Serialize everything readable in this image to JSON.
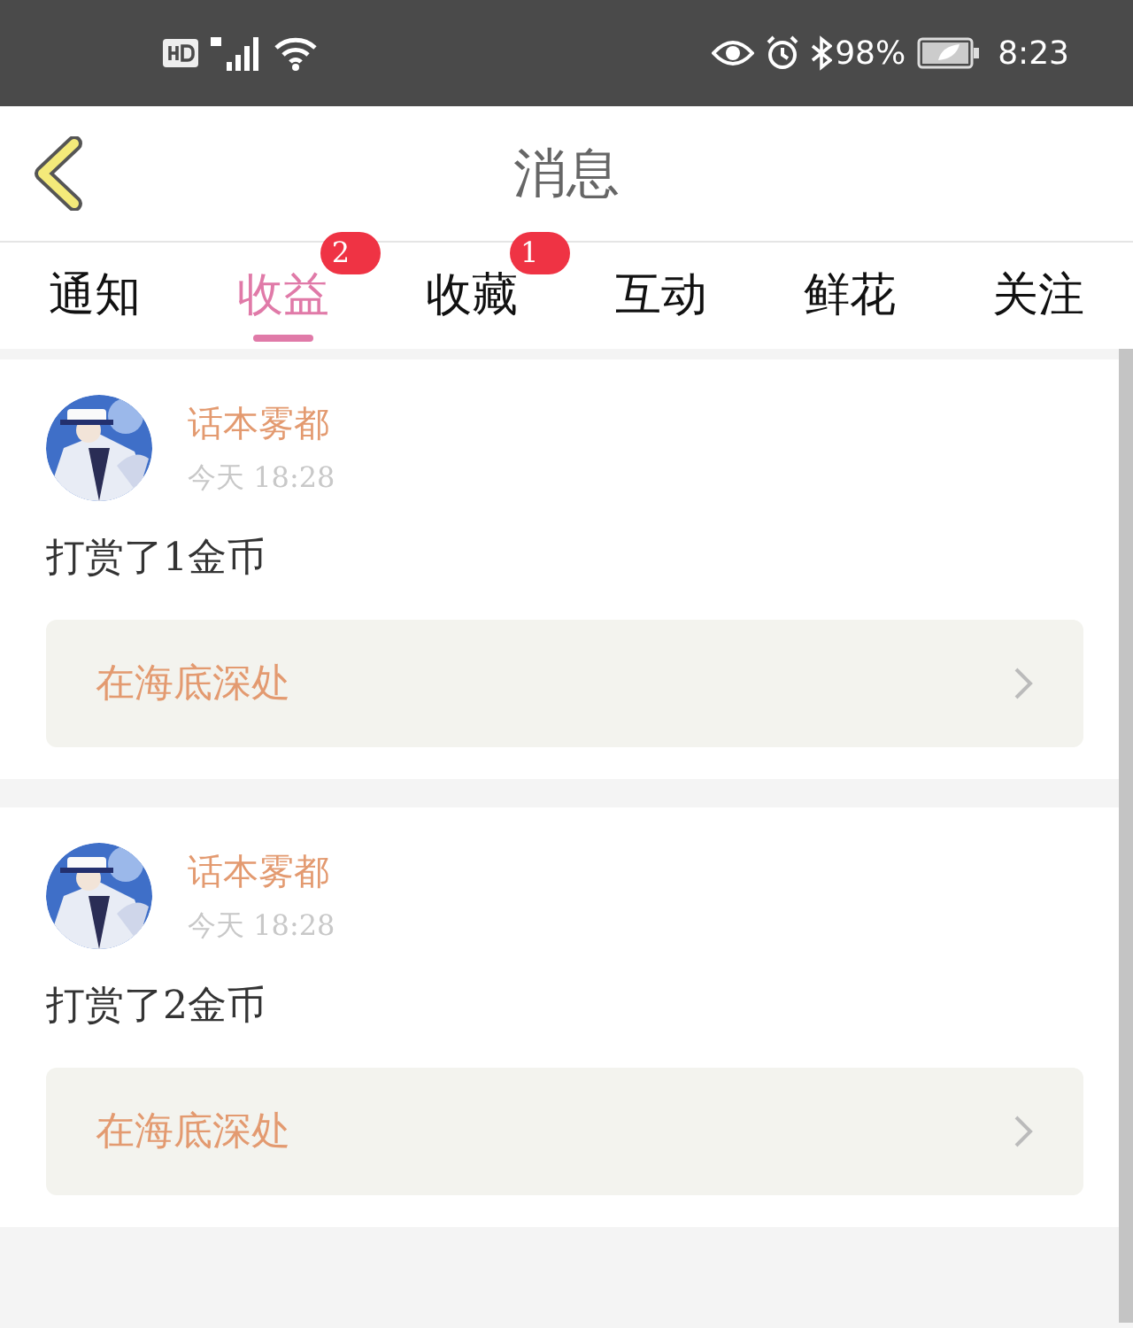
{
  "status_bar": {
    "battery": "98%",
    "time": "8:23"
  },
  "header": {
    "title": "消息"
  },
  "tabs": [
    {
      "label": "通知",
      "selected": false
    },
    {
      "label": "收益",
      "selected": true,
      "badge": "2"
    },
    {
      "label": "收藏",
      "selected": false,
      "badge": "1"
    },
    {
      "label": "互动",
      "selected": false
    },
    {
      "label": "鲜花",
      "selected": false
    },
    {
      "label": "关注",
      "selected": false
    }
  ],
  "messages": [
    {
      "user": "话本雾都",
      "time": "今天 18:28",
      "text": "打赏了1金币",
      "book": "在海底深处"
    },
    {
      "user": "话本雾都",
      "time": "今天 18:28",
      "text": "打赏了2金币",
      "book": "在海底深处"
    }
  ]
}
